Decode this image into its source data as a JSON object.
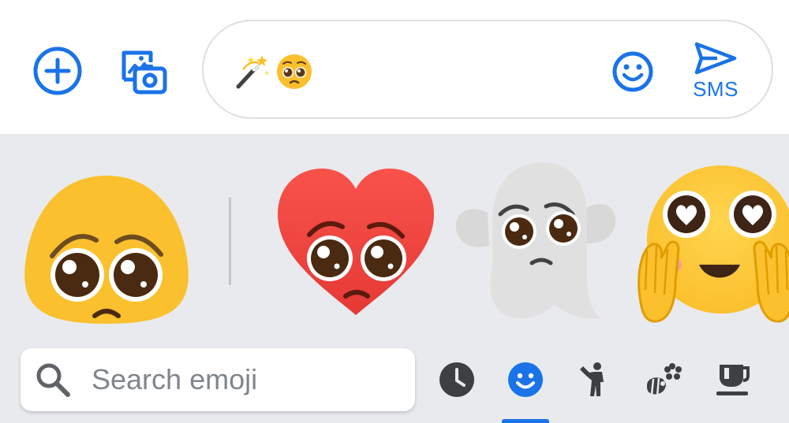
{
  "colors": {
    "accent": "#1a73e8",
    "panel_background": "#e8eaed",
    "category_icon": "#3c4043"
  },
  "toolbar": {
    "add_icon": "plus-circle-icon",
    "media_icon": "gallery-camera-icon"
  },
  "compose": {
    "text": "🪄🥺",
    "emoji_icon": "smiley-face-icon",
    "send_icon": "send-arrow-icon",
    "send_label": "SMS"
  },
  "emoji_kitchen": {
    "base_emoji": "pleading-face",
    "suggestions": [
      "pleading-heart",
      "pleading-ghost",
      "heart-eyes-hands-on-cheeks"
    ]
  },
  "search": {
    "placeholder": "Search emoji",
    "value": ""
  },
  "categories": [
    {
      "name": "recent",
      "icon": "clock-icon",
      "selected": false
    },
    {
      "name": "smileys",
      "icon": "smiley-icon",
      "selected": true
    },
    {
      "name": "people",
      "icon": "person-icon",
      "selected": false
    },
    {
      "name": "nature",
      "icon": "flower-bee-icon",
      "selected": false
    },
    {
      "name": "food",
      "icon": "coffee-cup-icon",
      "selected": false
    }
  ]
}
